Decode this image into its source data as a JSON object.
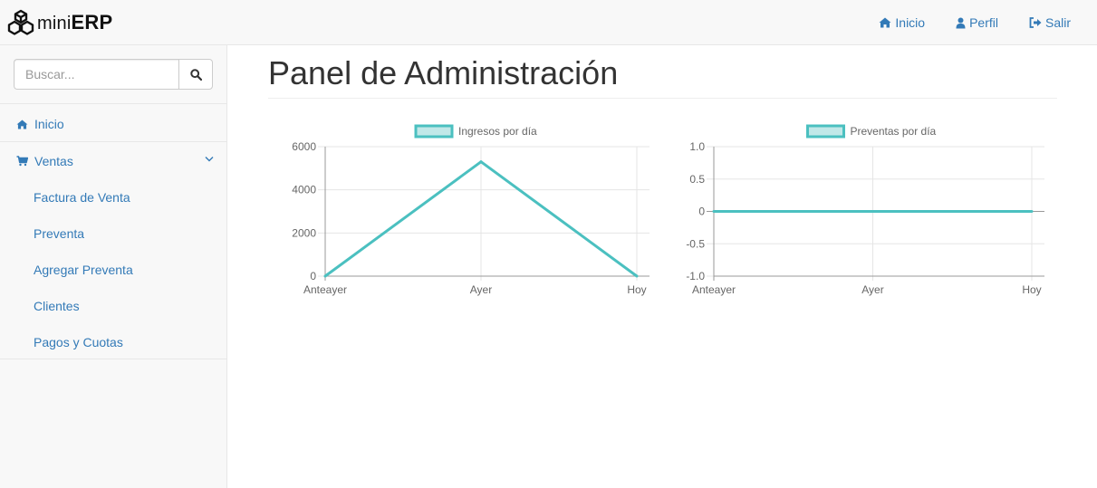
{
  "brand": {
    "light": "mini",
    "bold": "ERP"
  },
  "nav": [
    {
      "label": "Inicio",
      "icon": "home-icon"
    },
    {
      "label": "Perfil",
      "icon": "user-icon"
    },
    {
      "label": "Salir",
      "icon": "sign-out-icon"
    }
  ],
  "search": {
    "placeholder": "Buscar...",
    "value": ""
  },
  "sidebar": {
    "items": [
      {
        "label": "Inicio",
        "icon": "home-icon"
      },
      {
        "label": "Ventas",
        "icon": "cart-icon",
        "expanded": true,
        "children": [
          {
            "label": "Factura de Venta"
          },
          {
            "label": "Preventa"
          },
          {
            "label": "Agregar Preventa"
          },
          {
            "label": "Clientes"
          },
          {
            "label": "Pagos y Cuotas"
          }
        ]
      }
    ]
  },
  "page": {
    "title": "Panel de Administración"
  },
  "colors": {
    "accent": "#337ab7",
    "series_line": "#4bc0c0",
    "series_fill": "#c1e8e8"
  },
  "chart_data": [
    {
      "type": "line",
      "categories": [
        "Anteayer",
        "Ayer",
        "Hoy"
      ],
      "series": [
        {
          "name": "Ingresos por día",
          "values": [
            0,
            5300,
            0
          ]
        }
      ],
      "yticks": [
        "6000",
        "4000",
        "2000",
        "0"
      ],
      "ylim": [
        0,
        6000
      ],
      "grid": true,
      "legend": "top-center"
    },
    {
      "type": "line",
      "categories": [
        "Anteayer",
        "Ayer",
        "Hoy"
      ],
      "series": [
        {
          "name": "Preventas por día",
          "values": [
            0,
            0,
            0
          ]
        }
      ],
      "yticks": [
        "1.0",
        "0.5",
        "0",
        "-0.5",
        "-1.0"
      ],
      "ylim": [
        -1,
        1
      ],
      "grid": true,
      "legend": "top-center"
    }
  ]
}
